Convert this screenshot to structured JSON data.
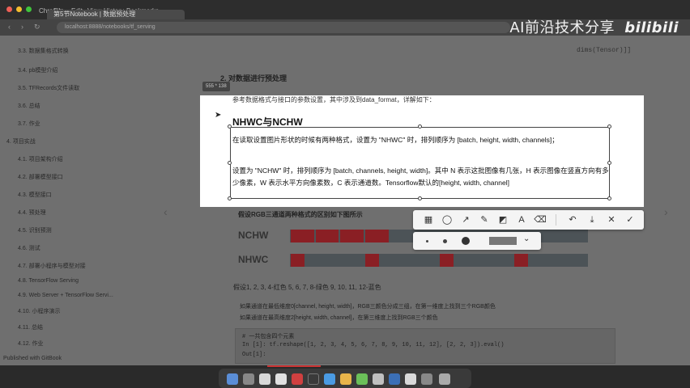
{
  "browser": {
    "tabs": [
      {
        "label": "Chrome"
      },
      {
        "label": "File"
      },
      {
        "label": "Edit"
      },
      {
        "label": "View"
      },
      {
        "label": "History"
      },
      {
        "label": "Bookmarks"
      },
      {
        "label": "第5节Notebook | 数据预处理"
      }
    ],
    "address": "localhost:8888/notebooks/tf_serving",
    "back_glyph": "‹",
    "forward_glyph": "›",
    "reload_glyph": "↻"
  },
  "watermark": {
    "text": "AI前沿技术分享",
    "logo": "bilibili"
  },
  "toc": {
    "items": [
      "3.3. 数据集格式转换",
      "3.4. pb模型介绍",
      "3.5. TFRecords文件读取",
      "3.6. 总结",
      "3.7. 作业",
      "4. 项目实战",
      "4.1. 项目架构介绍",
      "4.2. 部署模型接口",
      "4.3. 模型接口",
      "4.4. 预处理",
      "4.5. 识别预测",
      "4.6. 测试",
      "4.7. 部署小程序与模型对接",
      "4.8. TensorFlow Serving",
      "4.9. Web Server + TensorFlow Servi...",
      "4.10. 小程序演示",
      "4.11. 总结",
      "4.12. 作业",
      "Published with GitBook"
    ]
  },
  "notebook": {
    "input_tag": "dims(Tensor)]]",
    "section": "2. 对数据进行预处理",
    "section_sub": "参考数据格式与接口的参数设置，其中涉及到data_format，详解如下：",
    "strip_title": "假设RGB三通道两种格式的区别如下图所示",
    "row_nchw": "NCHW",
    "row_nhwc": "NHWC",
    "caption": "假设1, 2, 3, 4-红色 5, 6, 7, 8-绿色 9, 10, 11, 12-蓝色",
    "bullet1": "如果通道在最低维度0[channel, height, width]，RGB三颜色分成三组，在第一维度上找到三个RGB颜色",
    "bullet2": "如果通道在最高维度2[height, width, channel]，在第三维度上找到RGB三个颜色",
    "code_lines": [
      "#   一共包含四个元素",
      "In [1]: tf.reshape([1, 2, 3, 4, 5, 6, 7, 8, 9, 10, 11, 12], [2, 2, 3]).eval()",
      "Out[1]:"
    ]
  },
  "capture": {
    "dimensions": "555 * 138",
    "clipped_line": "参考数据格式与接口的参数设置，其中涉及到data_format，详解如下：",
    "title": "NHWC与NCHW",
    "para1": "在读取设置图片形状的时候有两种格式，设置为 \"NHWC\" 时，排列顺序为 [batch, height, width, channels]；",
    "para2": "设置为 \"NCHW\" 时，排列顺序为 [batch, channels, height, width]。其中 N 表示这批图像有几张，H 表示图像在竖直方向有多少像素，W 表示水平方向像素数，C 表示通道数。Tensorflow默认的[height, width, channel]"
  },
  "toolbar": {
    "tools": [
      {
        "icon": "mosaic-icon",
        "glyph": "▦"
      },
      {
        "icon": "ellipse-icon",
        "glyph": "◯"
      },
      {
        "icon": "arrow-icon",
        "glyph": "↗"
      },
      {
        "icon": "pen-icon",
        "glyph": "✎"
      },
      {
        "icon": "blur-icon",
        "glyph": "◩"
      },
      {
        "icon": "text-icon",
        "glyph": "A"
      },
      {
        "icon": "eraser-icon",
        "glyph": "⌫"
      },
      {
        "icon": "undo-icon",
        "glyph": "↶"
      },
      {
        "icon": "save-icon",
        "glyph": "⤓"
      },
      {
        "icon": "close-icon",
        "glyph": "✕"
      },
      {
        "icon": "confirm-icon",
        "glyph": "✓"
      }
    ],
    "color_chevron": "⌄"
  },
  "colors": {
    "strip_red": "#8a1f24",
    "strip_gray": "#4c5357"
  },
  "nchw_red_fraction": 0.333,
  "nhwc_pattern": "every third block red"
}
